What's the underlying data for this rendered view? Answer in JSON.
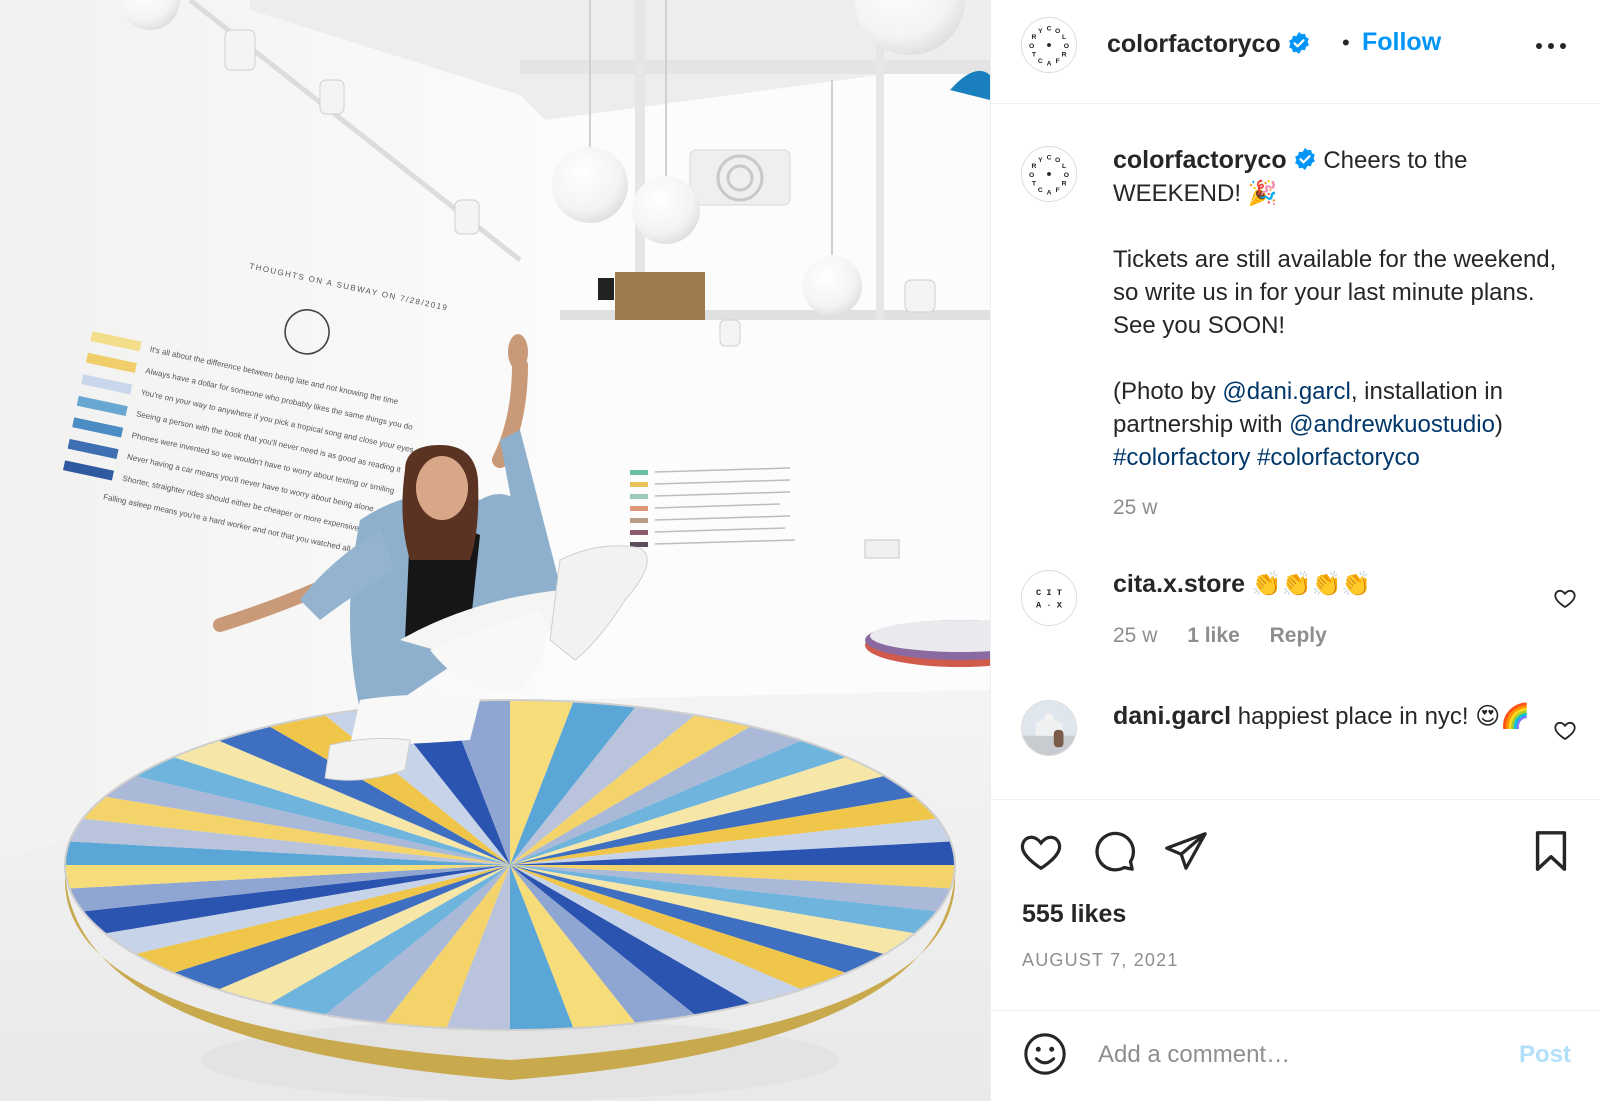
{
  "header": {
    "username": "colorfactoryco",
    "verified_icon": "verified-badge-icon",
    "separator": "•",
    "follow_label": "Follow",
    "more_icon": "more-options-icon",
    "avatar_letters": [
      "C",
      "O",
      "L",
      "O",
      "R",
      "F",
      "A",
      "C",
      "T",
      "O",
      "R",
      "Y"
    ]
  },
  "caption": {
    "username": "colorfactoryco",
    "line1": "Cheers to the WEEKEND! 🎉",
    "paragraph2": "Tickets are still available for the weekend, so write us in for your last minute plans. See you SOON!",
    "photo_prefix": "(Photo by ",
    "mention1": "@dani.garcl",
    "photo_middle": ", installation in partnership with ",
    "mention2": "@andrewkuostudio",
    "photo_suffix": ")",
    "hashtag1": "#colorfactory",
    "hashtag2": "#colorfactoryco",
    "time": "25 w"
  },
  "comments": [
    {
      "username": "cita.x.store",
      "text": "👏👏👏👏",
      "avatar_text": [
        "C I T",
        "A · X"
      ],
      "time": "25 w",
      "likes": "1 like",
      "reply": "Reply"
    },
    {
      "username": "dani.garcl",
      "text": "happiest place in nyc! 😍🌈"
    }
  ],
  "actions": {
    "like_icon": "heart-icon",
    "comment_icon": "comment-icon",
    "share_icon": "share-icon",
    "save_icon": "bookmark-icon",
    "likes": "555 likes",
    "date": "AUGUST 7, 2021"
  },
  "add_comment": {
    "emoji_icon": "emoji-icon",
    "placeholder": "Add a comment…",
    "post_label": "Post"
  },
  "colors": {
    "link_blue": "#0095f6",
    "mention_blue": "#00376b",
    "verified_blue": "#0095f6",
    "muted": "#8e8e8e",
    "post_disabled": "#b2dffc"
  },
  "photo": {
    "wall_panel_left": [
      "THOUGHTS ON A SUBWAY ON 7/28/2019",
      "It's all about the difference between being late and not knowing the time",
      "Always have a dollar for someone who probably likes the same things you do",
      "You're on your way to anywhere if you pick a tropical song and close your eyes",
      "Seeing a person with the book that you'll never need is as good as reading it",
      "Phones were invented so we wouldn't have to worry about texting or smiling",
      "Never having a car means you'll never have to worry about being alone",
      "Shorter, straighter rides should either be cheaper or more expensive than the others",
      "Falling asleep means you're a hard worker and not that you watched all the TV"
    ]
  }
}
